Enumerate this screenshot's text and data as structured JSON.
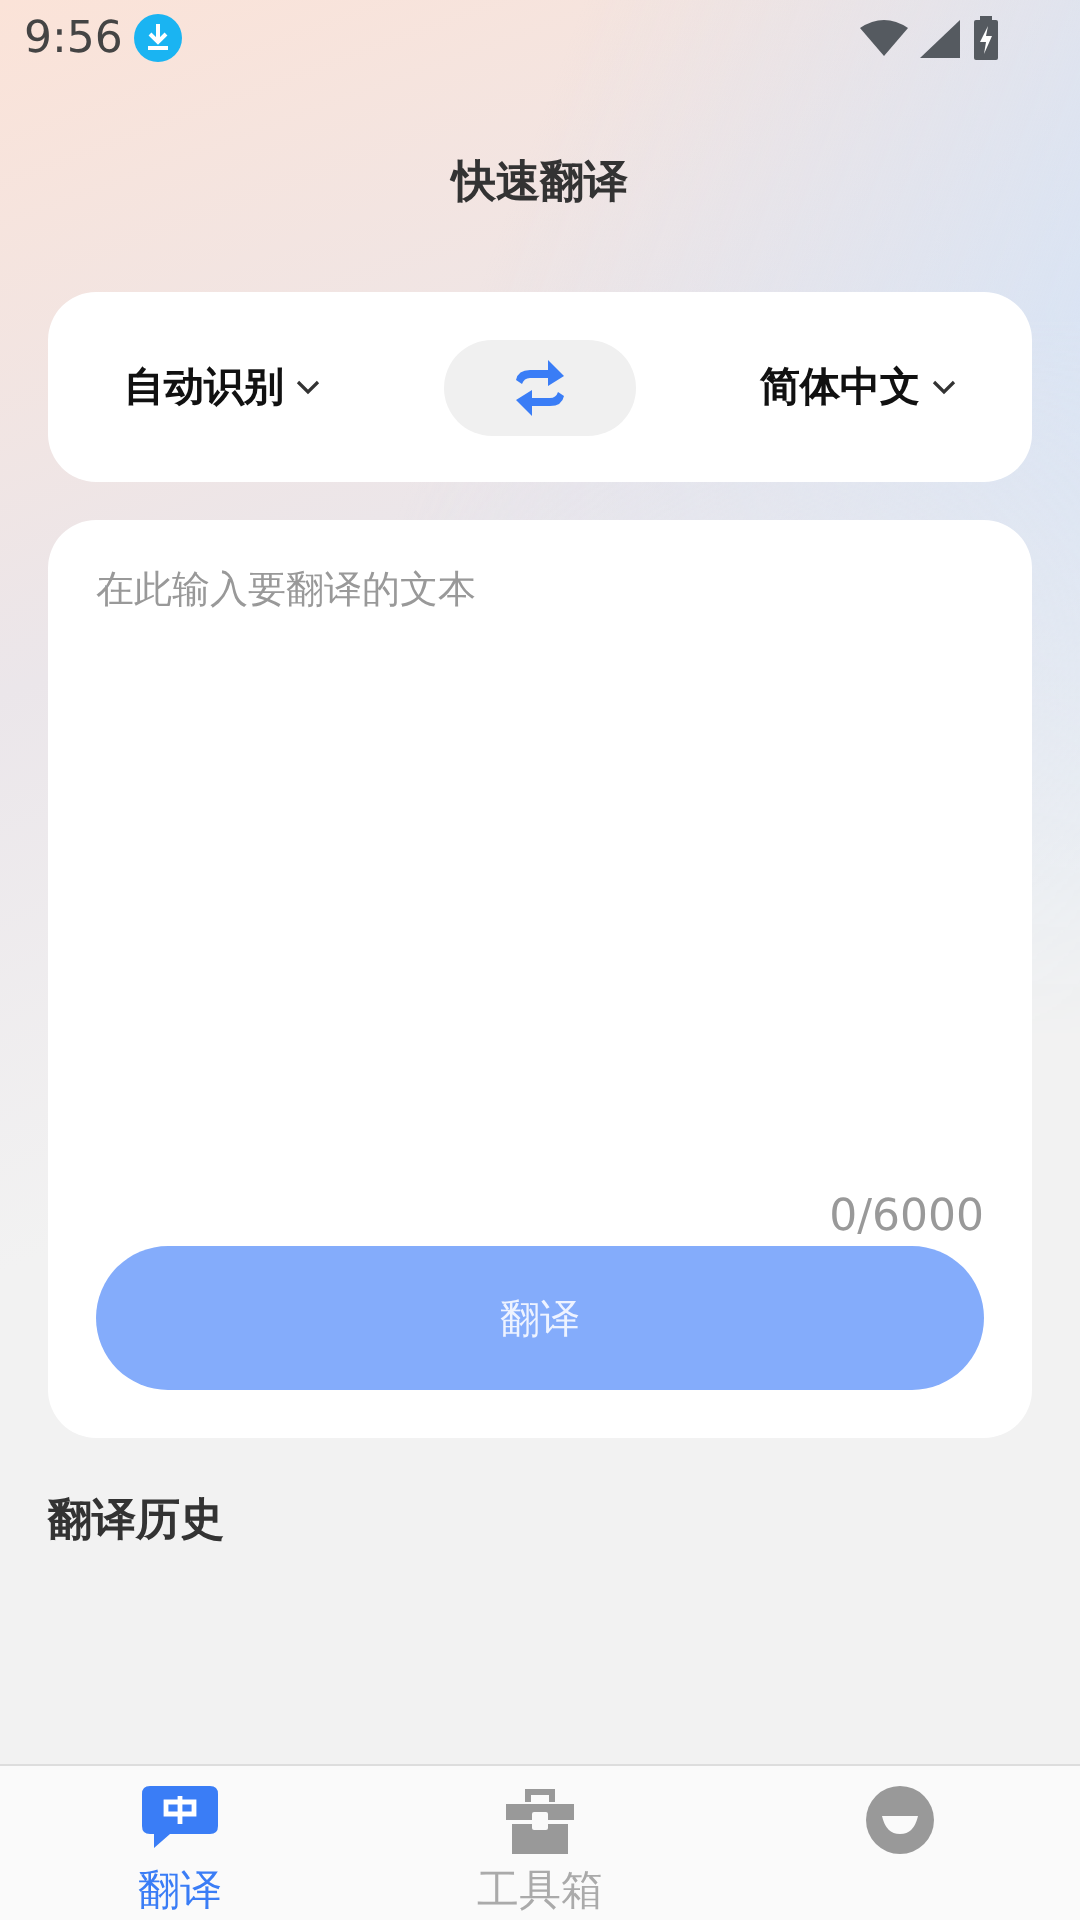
{
  "status_bar": {
    "time": "9:56"
  },
  "title": "快速翻译",
  "languages": {
    "source": "自动识别",
    "target": "简体中文"
  },
  "input": {
    "placeholder": "在此输入要翻译的文本",
    "counter": "0/6000"
  },
  "translate_button": {
    "label": "翻译",
    "disabled": true
  },
  "history": {
    "title": "翻译历史"
  },
  "tabs": [
    {
      "kind": "translate",
      "label": "翻译",
      "selected": true
    },
    {
      "kind": "toolbox",
      "label": "工具箱",
      "selected": false
    },
    {
      "kind": "profile",
      "selected": false
    }
  ]
}
